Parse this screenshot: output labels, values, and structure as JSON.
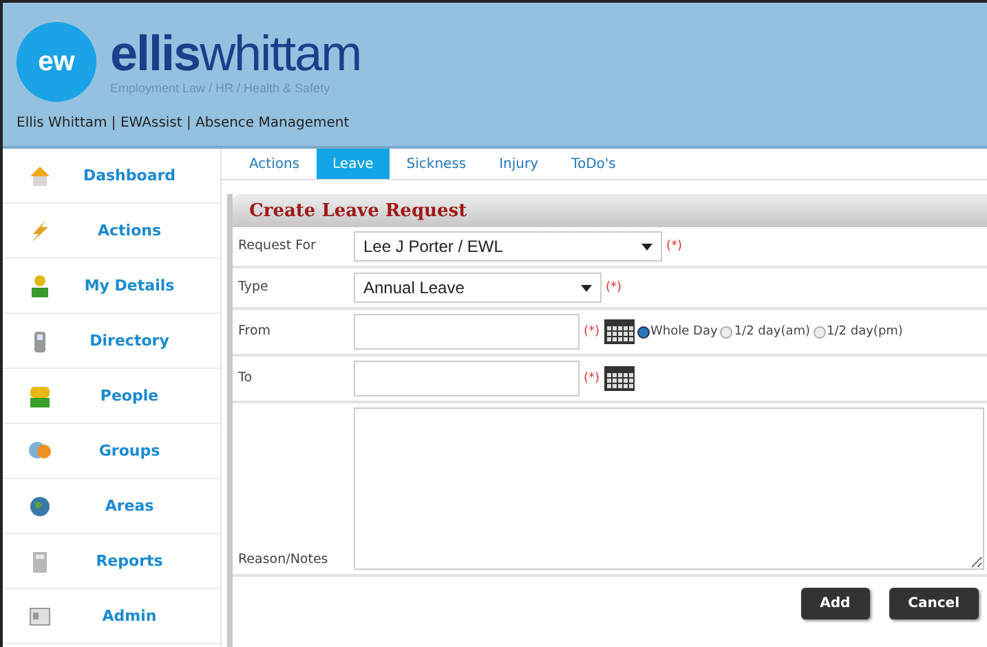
{
  "header": {
    "logo_badge": "ew",
    "logo": "**ellis**whittam",
    "tagline": "Employment Law / HR / Health & Safety",
    "breadcrumb": "Ellis Whittam | EWAssist | Absence Management"
  },
  "sidebar": {
    "items": [
      {
        "label": "Dashboard",
        "kind": "house"
      },
      {
        "label": "Actions",
        "kind": "bolt"
      },
      {
        "label": "My Details",
        "kind": "person"
      },
      {
        "label": "Directory",
        "kind": "phone"
      },
      {
        "label": "People",
        "kind": "people"
      },
      {
        "label": "Groups",
        "kind": "groups"
      },
      {
        "label": "Areas",
        "kind": "globe"
      },
      {
        "label": "Reports",
        "kind": "calculator"
      },
      {
        "label": "Admin",
        "kind": "card"
      }
    ]
  },
  "tabs": [
    {
      "label": "Actions",
      "selected": false
    },
    {
      "label": "Leave",
      "selected": true
    },
    {
      "label": "Sickness",
      "selected": false
    },
    {
      "label": "Injury",
      "selected": false
    },
    {
      "label": "ToDo's",
      "selected": false
    }
  ],
  "form": {
    "title": "Create Leave Request",
    "fields": [
      {
        "kind": "select",
        "label": "Request For",
        "value": "Lee J Porter / EWL",
        "required": "(*)"
      },
      {
        "kind": "select",
        "label": "Type",
        "value": "Annual Leave",
        "required": "(*)"
      },
      {
        "kind": "date",
        "label": "From",
        "required": "(*)",
        "options": [
          {
            "label": "Whole Day",
            "selected": true
          },
          {
            "label": "1/2 day(am)",
            "selected": false
          },
          {
            "label": "1/2 day(pm)",
            "selected": false
          }
        ]
      },
      {
        "kind": "date",
        "label": "To",
        "required": "(*)"
      },
      {
        "kind": "textarea",
        "label": "Reason/Notes"
      }
    ],
    "buttons": [
      "Add",
      "Cancel"
    ]
  }
}
